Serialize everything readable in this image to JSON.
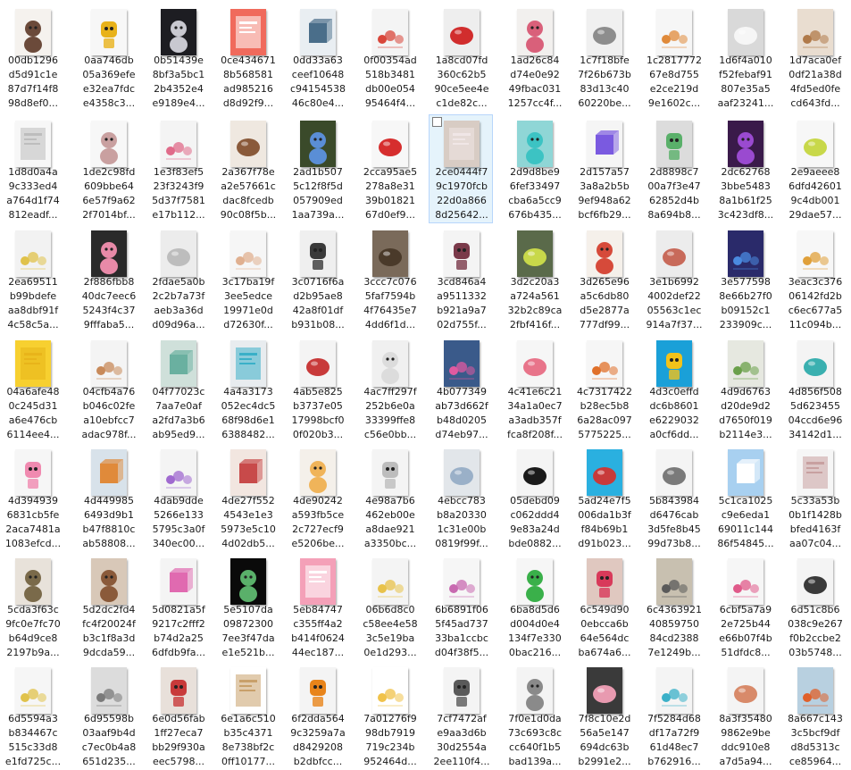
{
  "files": [
    {
      "name": "00db1296\nd5d91c1e\n87d7f14f8\n98d8ef0...",
      "bg": "#f5f2ee",
      "fg": "#6b4a3a",
      "shape": "figure"
    },
    {
      "name": "0aa746db\n05a369efe\ne32ea7fdc\ne4358c3...",
      "bg": "#f7f7f7",
      "fg": "#e8b21a",
      "shape": "robot"
    },
    {
      "name": "0b51439e\n8bf3a5bc1\n2b4352e4\ne9189e4...",
      "bg": "#1d1d22",
      "fg": "#c8c8d0",
      "shape": "figure"
    },
    {
      "name": "0ce434671\n8b568581\nad985216\nd8d92f9...",
      "bg": "#f06a5c",
      "fg": "#ffffff",
      "shape": "poster"
    },
    {
      "name": "0dd33a63\nceef10648\nc94154538\n46c80e4...",
      "bg": "#e9eef2",
      "fg": "#4a6e8a",
      "shape": "box"
    },
    {
      "name": "0f00354ad\n518b3481\ndb00e054\n95464f4...",
      "bg": "#f4f4f4",
      "fg": "#d9463a",
      "shape": "set"
    },
    {
      "name": "1a8cd07fd\n360c62b5\n90ce5ee4e\nc1de82c...",
      "bg": "#eeeeee",
      "fg": "#d12d2d",
      "shape": "blob"
    },
    {
      "name": "1ad26c84\nd74e0e92\n49fbac031\n1257cc4f...",
      "bg": "#f2f0ee",
      "fg": "#d9607a",
      "shape": "figure"
    },
    {
      "name": "1c7f18bfe\n7f26b673b\n83d13c40\n60220be...",
      "bg": "#f0f0f0",
      "fg": "#8d8d8d",
      "shape": "blob"
    },
    {
      "name": "1c2817772\n67e8d755\ne2ce219d\n9e1602c...",
      "bg": "#f6f6f6",
      "fg": "#e08a3a",
      "shape": "set"
    },
    {
      "name": "1d6f4a010\nf52febaf91\n807e35a5\naaf23241...",
      "bg": "#d9d9d9",
      "fg": "#f6f6f6",
      "shape": "blob"
    },
    {
      "name": "1d7aca0ef\n0df21a38d\n4fd5ed0fe\ncd643fd...",
      "bg": "#e9ddd0",
      "fg": "#b07a4a",
      "shape": "set"
    },
    {
      "name": "1d8d0a4a\n9c333ed4\na764d1f74\n812eadf...",
      "bg": "#f7f7f7",
      "fg": "#bdbdbd",
      "shape": "poster"
    },
    {
      "name": "1de2c98fd\n609bbe64\n6e57f9a62\n2f7014bf...",
      "bg": "#f7f7f7",
      "fg": "#c9a0a0",
      "shape": "figure"
    },
    {
      "name": "1e3f83ef5\n23f3243f9\n5d37f7581\ne17b112...",
      "bg": "#f4f4f4",
      "fg": "#e06b8a",
      "shape": "set"
    },
    {
      "name": "2a367f78e\na2e57661c\ndac8fcedb\n90c08f5b...",
      "bg": "#efe8e0",
      "fg": "#8a5a3a",
      "shape": "blob"
    },
    {
      "name": "2ad1b507\n5c12f8f5d\n057909ed\n1aa739a...",
      "bg": "#3a4a2a",
      "fg": "#5a8ed6",
      "shape": "figure"
    },
    {
      "name": "2cca95ae5\n278a8e31\n39b01821\n67d0ef9...",
      "bg": "#f7f7f7",
      "fg": "#d62e2e",
      "shape": "blob"
    },
    {
      "name": "2ce0444f7\n9c1970fcb\n22d0a866\n8d25642...",
      "bg": "#d8ccc4",
      "fg": "#f0e6e6",
      "shape": "poster",
      "selected": true
    },
    {
      "name": "2d9d8be9\n6fef33497\ncba6a5cc9\n676b435...",
      "bg": "#8fd6d6",
      "fg": "#3cc3c3",
      "shape": "figure"
    },
    {
      "name": "2d157a57\n3a8a2b5b\n9ef948a62\nbcf6fb29...",
      "bg": "#f5f5f5",
      "fg": "#7a5ae0",
      "shape": "box"
    },
    {
      "name": "2d8898c7\n00a7f3e47\n62852d4b\n8a694b8...",
      "bg": "#dcdcdc",
      "fg": "#5ab06a",
      "shape": "robot"
    },
    {
      "name": "2dc62768\n3bbe5483\n8a1b61f25\n3c423df8...",
      "bg": "#3a1a4a",
      "fg": "#9a4ad0",
      "shape": "figure"
    },
    {
      "name": "2e9aeee8\n6dfd42601\n9c4db001\n29dae57...",
      "bg": "#f7f7f7",
      "fg": "#c8d84a",
      "shape": "blob"
    },
    {
      "name": "2ea69511\nb99bdefe\naa8dbf91f\n4c58c5a...",
      "bg": "#f2f2f2",
      "fg": "#e0c24a",
      "shape": "set"
    },
    {
      "name": "2f886fbb8\n40dc7eec6\n5243f4c37\n9fffaba5...",
      "bg": "#2a2a2a",
      "fg": "#e88aa8",
      "shape": "figure"
    },
    {
      "name": "2fdae5a0b\n2c2b7a73f\naeb3a36d\nd09d96a...",
      "bg": "#ececec",
      "fg": "#bdbdbd",
      "shape": "blob"
    },
    {
      "name": "3c17ba19f\n3ee5edce\n19971e0d\nd72630f...",
      "bg": "#f6f6f6",
      "fg": "#e0b090",
      "shape": "set"
    },
    {
      "name": "3c0716f6a\nd2b95ae8\n42a8f01df\nb931b08...",
      "bg": "#efefef",
      "fg": "#3a3a3a",
      "shape": "robot"
    },
    {
      "name": "3ccc7c076\n5faf7594b\n4f76435e7\n4dd6f1d...",
      "bg": "#7a6a5a",
      "fg": "#4a3a2a",
      "shape": "blob"
    },
    {
      "name": "3cd846a4\na9511332\nb921a9a7\n02d755f...",
      "bg": "#f4f4f4",
      "fg": "#7a3a4a",
      "shape": "robot"
    },
    {
      "name": "3d2c20a3\na724a561\n32b2c89ca\n2fbf416f...",
      "bg": "#5a6a4a",
      "fg": "#c8d84a",
      "shape": "blob"
    },
    {
      "name": "3d265e96\na5c6db80\nd5e2877a\n777df99...",
      "bg": "#f5f0ea",
      "fg": "#d64a3a",
      "shape": "figure"
    },
    {
      "name": "3e1b6992\n4002def22\n05563c1ec\n914a7f37...",
      "bg": "#ececec",
      "fg": "#c86a5a",
      "shape": "blob"
    },
    {
      "name": "3e577598\n8e66b27f0\nb09152c1\n233909c...",
      "bg": "#2a2a6a",
      "fg": "#4a8ae0",
      "shape": "set"
    },
    {
      "name": "3eac3c376\n06142fd2b\nc6ec677a5\n11c094b...",
      "bg": "#f7f7f7",
      "fg": "#e0a03a",
      "shape": "set"
    },
    {
      "name": "04a6afe48\n0c245d31\na6e476cb\n6114ee4...",
      "bg": "#f7d030",
      "fg": "#e8b41a",
      "shape": "poster"
    },
    {
      "name": "04cfb4a76\nb046c02fe\na10ebfcc7\nadac978f...",
      "bg": "#f4f4f4",
      "fg": "#c88a5a",
      "shape": "set"
    },
    {
      "name": "04f77023c\n7aa7e0af\na2fd7a3b6\nab95ed9...",
      "bg": "#cfe0da",
      "fg": "#6ab0a0",
      "shape": "box"
    },
    {
      "name": "4a4a3173\n052ec4dc5\n68f98d6e1\n6388482...",
      "bg": "#e8ecef",
      "fg": "#3ab0c8",
      "shape": "poster"
    },
    {
      "name": "4ab5e825\nb3737e05\n17998bcf0\n0f020b3...",
      "bg": "#f4f4f4",
      "fg": "#c83a3a",
      "shape": "blob"
    },
    {
      "name": "4ac7ff297f\n252b6e0a\n33399ffe8\nc56e0bb...",
      "bg": "#f0f0f0",
      "fg": "#dcdcdc",
      "shape": "figure"
    },
    {
      "name": "4b077349\nab73d662f\nb48d0205\nd74eb97...",
      "bg": "#3a5a8a",
      "fg": "#e05aa0",
      "shape": "set"
    },
    {
      "name": "4c41e6c21\n34a1a0ec7\na3adb357f\nfca8f208f...",
      "bg": "#f6f6f6",
      "fg": "#e8748a",
      "shape": "blob"
    },
    {
      "name": "4c7317422\nb28ec5b8\n6a28ac097\n5775225...",
      "bg": "#f6f6f6",
      "fg": "#e0702a",
      "shape": "set"
    },
    {
      "name": "4d3c0effd\ndc6b8601\ne6229032\na0cf6dd...",
      "bg": "#1aa0d8",
      "fg": "#f2c21a",
      "shape": "robot"
    },
    {
      "name": "4d9d6763\nd20de9d2\nd7650f019\nb2114e3...",
      "bg": "#e6e8e0",
      "fg": "#6aa04a",
      "shape": "set"
    },
    {
      "name": "4d856f508\n5d623455\n04ccd6e96\n34142d1...",
      "bg": "#f4f4f4",
      "fg": "#3ab0b0",
      "shape": "blob"
    },
    {
      "name": "4d394939\n6831cb5fe\n2aca7481a\n1083efcd...",
      "bg": "#f6f6f6",
      "fg": "#f08ab0",
      "shape": "robot"
    },
    {
      "name": "4d449985\n6493d9b1\nb47f8810c\nab58808...",
      "bg": "#d8e2ea",
      "fg": "#e08a3a",
      "shape": "box"
    },
    {
      "name": "4dab9dde\n5266e133\n5795c3a0f\n340ec00...",
      "bg": "#f4f4f4",
      "fg": "#a06ad0",
      "shape": "set"
    },
    {
      "name": "4de27f552\n4543e1e3\n5973e5c10\n4d02db5...",
      "bg": "#f2e6e0",
      "fg": "#c84a4a",
      "shape": "box"
    },
    {
      "name": "4de90242\na593fb5ce\n2c727ecf9\ne5206be...",
      "bg": "#f4f0ea",
      "fg": "#f0b45a",
      "shape": "figure"
    },
    {
      "name": "4e98a7b6\n462eb00e\na8dae921\na3350bc...",
      "bg": "#f4f4f4",
      "fg": "#bdbdbd",
      "shape": "robot"
    },
    {
      "name": "4ebcc783\nb8a20330\n1c31e00b\n0819f99f...",
      "bg": "#e2e6ea",
      "fg": "#9ab0c8",
      "shape": "blob"
    },
    {
      "name": "05debd09\nc062ddd4\n9e83a24d\nbde0882...",
      "bg": "#f4f4f4",
      "fg": "#1a1a1a",
      "shape": "blob"
    },
    {
      "name": "5ad24e7f5\n006da1b3f\nf84b69b1\nd91b023...",
      "bg": "#2ab0e0",
      "fg": "#c83a3a",
      "shape": "blob"
    },
    {
      "name": "5b843984\nd6476cab\n3d5fe8b45\n99d73b8...",
      "bg": "#f4f4f4",
      "fg": "#7a7a7a",
      "shape": "blob"
    },
    {
      "name": "5c1ca1025\nc9e6eda1\n69011c144\n86f54845...",
      "bg": "#a8d0f0",
      "fg": "#ffffff",
      "shape": "box"
    },
    {
      "name": "5c33a53b\n0b1f1428b\nbfed4163f\naa07c04...",
      "bg": "#f6f6f6",
      "fg": "#c8a0a0",
      "shape": "poster"
    },
    {
      "name": "5cda3f63c\n9fc0e7fc70\nb64d9ce8\n2197b9a...",
      "bg": "#e8e2da",
      "fg": "#7a6a4a",
      "shape": "figure"
    },
    {
      "name": "5d2dc2fd4\nfc4f20024f\nb3c1f8a3d\n9dcda59...",
      "bg": "#d8c8b8",
      "fg": "#8a5a3a",
      "shape": "figure"
    },
    {
      "name": "5d0821a5f\n9217c2fff2\nb74d2a25\n6dfdb9fa...",
      "bg": "#f4f4f4",
      "fg": "#e06ab0",
      "shape": "box"
    },
    {
      "name": "5e5107da\n09872300\n7ee3f47da\ne1e521b...",
      "bg": "#0a0a0a",
      "fg": "#5ab06a",
      "shape": "figure"
    },
    {
      "name": "5eb84747\nc355ff4a2\nb414f0624\n44ec187...",
      "bg": "#f4a0b8",
      "fg": "#ffffff",
      "shape": "poster"
    },
    {
      "name": "06b6d8c0\nc58ee4e58\n3c5e19ba\n0e1d293...",
      "bg": "#f4f4f4",
      "fg": "#e8c24a",
      "shape": "set"
    },
    {
      "name": "6b6891f06\n5f45ad737\n33ba1ccbc\nd04f38f5...",
      "bg": "#f6f6f6",
      "fg": "#c86ab0",
      "shape": "set"
    },
    {
      "name": "6ba8d5d6\nd004d0e4\n134f7e330\n0bac216...",
      "bg": "#f6f6f6",
      "fg": "#3ab04a",
      "shape": "figure"
    },
    {
      "name": "6c549d90\n0ebcca6b\n64e564dc\nba674a6...",
      "bg": "#e0c8c0",
      "fg": "#d83a5a",
      "shape": "robot"
    },
    {
      "name": "6c4363921\n40859750\n84cd2388\n7e1249b...",
      "bg": "#c8c0b0",
      "fg": "#5a5a5a",
      "shape": "set"
    },
    {
      "name": "6cbf5a7a9\n2e725b44\ne66b07f4b\n51dfdc8...",
      "bg": "#f6f6f6",
      "fg": "#e05a8a",
      "shape": "set"
    },
    {
      "name": "6d51c8b6\n038c9e267\nf0b2ccbe2\n03b5748...",
      "bg": "#f4f4f4",
      "fg": "#3a3a3a",
      "shape": "blob"
    },
    {
      "name": "6d5594a3\nb834467c\n515c33d8\ne1fd725c...",
      "bg": "#f6f6f6",
      "fg": "#e0c24a",
      "shape": "set"
    },
    {
      "name": "6d95598b\n03aaf9b4d\nc7ec0b4a8\n651d235...",
      "bg": "#dcdcdc",
      "fg": "#7a7a7a",
      "shape": "set"
    },
    {
      "name": "6e0d56fab\n1ff27eca7\nbb29f930a\neec5798...",
      "bg": "#e8e0da",
      "fg": "#c83a3a",
      "shape": "robot"
    },
    {
      "name": "6e1a6c510\nb35c4371\n8e738bf2c\n0ff10177...",
      "bg": "#ffffff",
      "fg": "#c8a06a",
      "shape": "poster"
    },
    {
      "name": "6f2dda564\n9c3259a7a\nd8429208\nb2dbfcc...",
      "bg": "#f4f4f4",
      "fg": "#e8841a",
      "shape": "robot"
    },
    {
      "name": "7a01276f9\n98db7919\n719c234b\n952464d...",
      "bg": "#ffffff",
      "fg": "#f0c24a",
      "shape": "set"
    },
    {
      "name": "7cf7472af\ne9aa3d6b\n30d2554a\n2ee110f4...",
      "bg": "#f4f4f4",
      "fg": "#5a5a5a",
      "shape": "robot"
    },
    {
      "name": "7f0e1d0da\n73c693c8c\ncc640f1b5\nbad139a...",
      "bg": "#f4f4f4",
      "fg": "#8a8a8a",
      "shape": "figure"
    },
    {
      "name": "7f8c10e2d\n56a5e147\n694dc63b\nb2991e2...",
      "bg": "#3a3a3a",
      "fg": "#e89ab0",
      "shape": "blob"
    },
    {
      "name": "7f5284d68\ndf17a72f9\n61d48ec7\nb762916...",
      "bg": "#f4f4f4",
      "fg": "#3ab0c8",
      "shape": "set"
    },
    {
      "name": "8a3f35480\n9862e9be\nddc910e8\na7d5a94...",
      "bg": "#f4f4f4",
      "fg": "#d88a6a",
      "shape": "blob"
    },
    {
      "name": "8a667c143\n3c5bcf9df\nd8d5313c\nce85964...",
      "bg": "#b8d0e0",
      "fg": "#e0602a",
      "shape": "set"
    }
  ]
}
